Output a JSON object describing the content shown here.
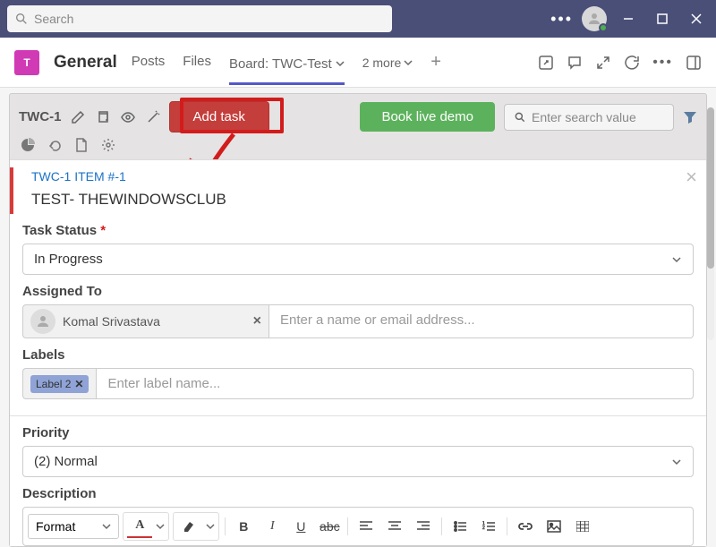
{
  "titlebar": {
    "search_placeholder": "Search"
  },
  "channel": {
    "team_initial": "T",
    "name": "General",
    "tabs": {
      "posts": "Posts",
      "files": "Files",
      "board": "Board: TWC-Test",
      "more": "2 more"
    }
  },
  "board": {
    "id": "TWC-1",
    "add_task_label": "Add task",
    "demo_label": "Book live demo",
    "search_placeholder": "Enter search value"
  },
  "task": {
    "item_id": "TWC-1 ITEM #-1",
    "title": "TEST- THEWINDOWSCLUB",
    "status_label": "Task Status",
    "status_value": "In Progress",
    "assigned_label": "Assigned To",
    "assigned_person": "Komal Srivastava",
    "assigned_input_placeholder": "Enter a name or email address...",
    "labels_label": "Labels",
    "label_chip": "Label 2",
    "labels_input_placeholder": "Enter label name...",
    "priority_label": "Priority",
    "priority_value": "(2) Normal",
    "description_label": "Description",
    "format_label": "Format"
  }
}
